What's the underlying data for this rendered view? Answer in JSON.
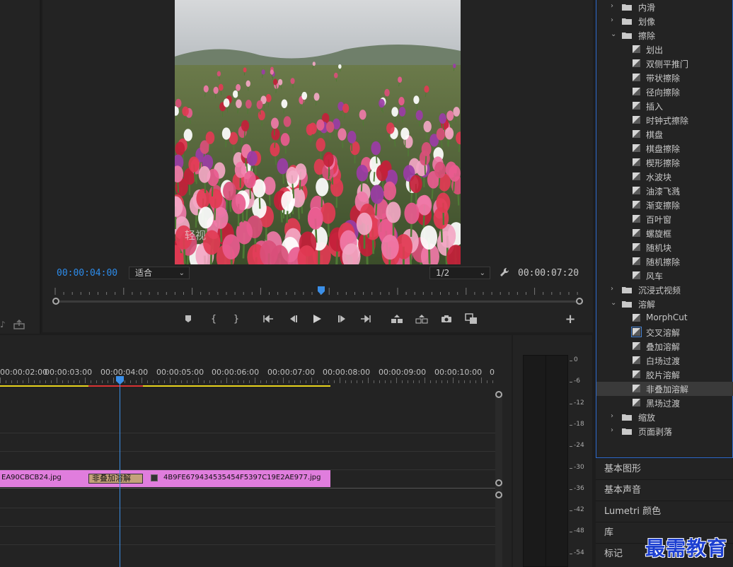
{
  "program_monitor": {
    "current_timecode": "00:00:04:00",
    "duration_timecode": "00:00:07:20",
    "zoom_level": "适合",
    "resolution": "1/2",
    "video_watermark": "轻视"
  },
  "timeline": {
    "ruler": [
      "00:00:02:00",
      "00:00:03:00",
      "00:00:04:00",
      "00:00:05:00",
      "00:00:06:00",
      "00:00:07:00",
      "00:00:08:00",
      "00:00:09:00",
      "00:00:10:00",
      "0"
    ],
    "clip_left_name": "EA90CBCB24.jpg",
    "transition_name": "非叠加溶解",
    "clip_right_name": "4B9FE6794345354​54F5397C19E2AE977.jpg"
  },
  "audio_meter": {
    "labels": [
      "0",
      "-6",
      "-12",
      "-18",
      "-24",
      "-30",
      "-36",
      "-42",
      "-48",
      "-54"
    ]
  },
  "effects": {
    "rows": [
      {
        "type": "folder",
        "state": "collapsed",
        "label": "内滑"
      },
      {
        "type": "folder",
        "state": "collapsed",
        "label": "划像"
      },
      {
        "type": "folder",
        "state": "expanded",
        "label": "擦除"
      },
      {
        "type": "item",
        "label": "划出"
      },
      {
        "type": "item",
        "label": "双侧平推门"
      },
      {
        "type": "item",
        "label": "带状擦除"
      },
      {
        "type": "item",
        "label": "径向擦除"
      },
      {
        "type": "item",
        "label": "插入"
      },
      {
        "type": "item",
        "label": "时钟式擦除"
      },
      {
        "type": "item",
        "label": "棋盘"
      },
      {
        "type": "item",
        "label": "棋盘擦除"
      },
      {
        "type": "item",
        "label": "楔形擦除"
      },
      {
        "type": "item",
        "label": "水波块"
      },
      {
        "type": "item",
        "label": "油漆飞溅"
      },
      {
        "type": "item",
        "label": "渐变擦除"
      },
      {
        "type": "item",
        "label": "百叶窗"
      },
      {
        "type": "item",
        "label": "螺旋框"
      },
      {
        "type": "item",
        "label": "随机块"
      },
      {
        "type": "item",
        "label": "随机擦除"
      },
      {
        "type": "item",
        "label": "风车"
      },
      {
        "type": "folder",
        "state": "collapsed",
        "label": "沉浸式视频"
      },
      {
        "type": "folder",
        "state": "expanded",
        "label": "溶解"
      },
      {
        "type": "item",
        "label": "MorphCut"
      },
      {
        "type": "item",
        "label": "交叉溶解",
        "boxed": true
      },
      {
        "type": "item",
        "label": "叠加溶解"
      },
      {
        "type": "item",
        "label": "白场过渡"
      },
      {
        "type": "item",
        "label": "胶片溶解"
      },
      {
        "type": "item",
        "label": "非叠加溶解",
        "selected": true
      },
      {
        "type": "item",
        "label": "黑场过渡"
      },
      {
        "type": "folder",
        "state": "collapsed",
        "label": "缩放"
      },
      {
        "type": "folder",
        "state": "collapsed",
        "label": "页面剥落"
      }
    ]
  },
  "lower_panels": [
    "基本图形",
    "基本声音",
    "Lumetri 颜色",
    "库",
    "标记"
  ],
  "watermark": "最需教育",
  "colors": {
    "accent_blue": "#2d8ceb",
    "clip_pink": "#e07ddd",
    "render_yellow": "#e8d41c",
    "render_red": "#d93333"
  }
}
